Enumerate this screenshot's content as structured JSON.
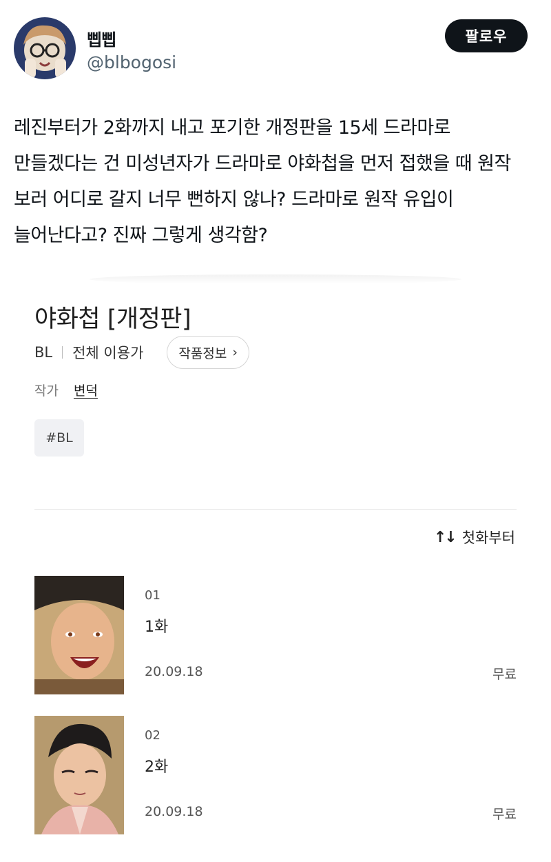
{
  "tweet": {
    "display_name": "삡삡",
    "handle": "@blbogosi",
    "follow_label": "팔로우",
    "text": "레진부터가 2화까지 내고 포기한 개정판을 15세 드라마로 만들겠다는 건 미성년자가 드라마로 야화첩을 먼저 접했을 때 원작 보러 어디로 갈지 너무 뻔하지 않나? 드라마로 원작 유입이 늘어난다고? 진짜 그렇게 생각함?"
  },
  "comic": {
    "title": "야화첩 [개정판]",
    "genre": "BL",
    "rating": "전체 이용가",
    "info_button": "작품정보",
    "author_label": "작가",
    "author_name": "변덕",
    "tag": "#BL",
    "sort_icon": "↑↓",
    "sort_label": "첫화부터",
    "episodes": [
      {
        "num": "01",
        "title": "1화",
        "date": "20.09.18",
        "price": "무료"
      },
      {
        "num": "02",
        "title": "2화",
        "date": "20.09.18",
        "price": "무료"
      }
    ]
  },
  "colors": {
    "follow_bg": "#0f1419",
    "handle": "#536471",
    "tag_bg": "#f0f1f4"
  }
}
